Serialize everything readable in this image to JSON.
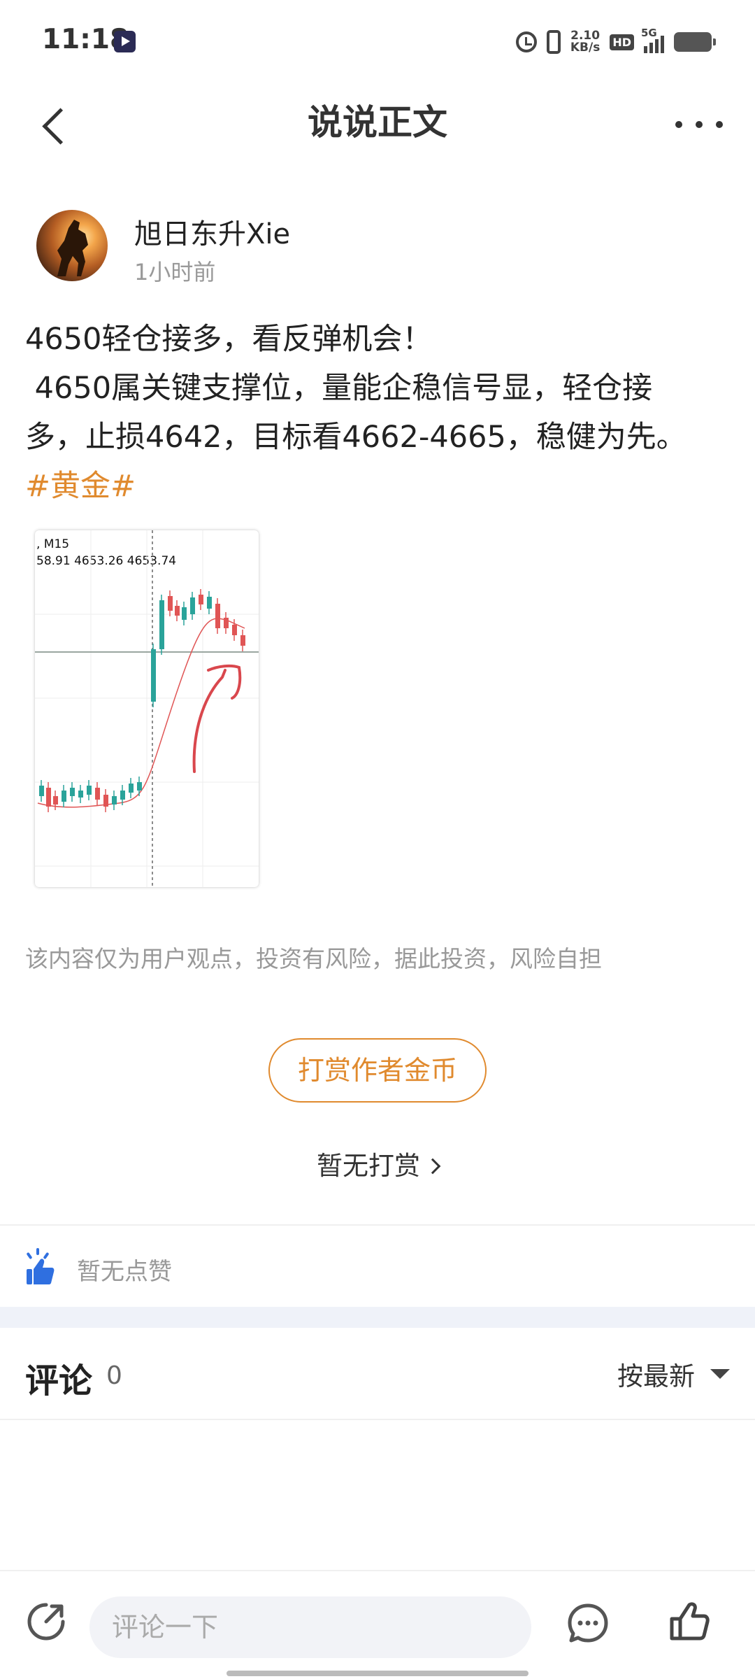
{
  "status_bar": {
    "time": "11:18",
    "net_speed_value": "2.10",
    "net_speed_unit": "KB/s",
    "hd_label": "HD",
    "signal_label": "5G",
    "icons": [
      "app-notification-icon",
      "alarm-icon",
      "vibrate-icon",
      "hd-icon",
      "signal-icon",
      "battery-icon"
    ]
  },
  "header": {
    "title": "说说正文",
    "back_icon": "chevron-left-icon",
    "more_icon": "more-dots-icon"
  },
  "post": {
    "author": "旭日东升Xie",
    "time": "1小时前",
    "lines": [
      "4650轻仓接多，看反弹机会！",
      " 4650属关键支撑位，量能企稳信号显，轻仓接",
      "多，止损4642，目标看4662-4665，稳健为先。"
    ],
    "hashtag": "#黄金#",
    "image": {
      "label_timeframe": ", M15",
      "label_prices": "58.91 4653.26 4653.74"
    },
    "disclaimer": "该内容仅为用户观点，投资有风险，据此投资，风险自担"
  },
  "reward": {
    "button_label": "打赏作者金币",
    "status": "暂无打赏"
  },
  "likes": {
    "text": "暂无点赞"
  },
  "comments": {
    "title": "评论",
    "count": "0",
    "sort_label": "按最新"
  },
  "bottom_bar": {
    "input_placeholder": "评论一下"
  },
  "colors": {
    "accent": "#e08a2e",
    "like_blue": "#2f6fe0",
    "candle_red": "#e05555",
    "candle_teal": "#2aa39a",
    "section_gap": "#eff2f9"
  }
}
